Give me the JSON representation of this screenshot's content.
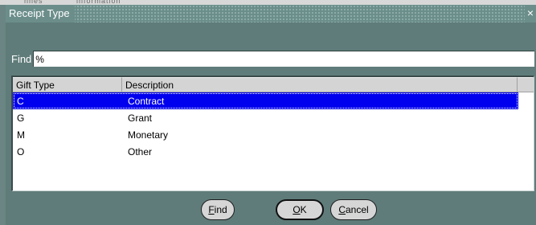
{
  "dialog": {
    "title": "Receipt Type",
    "close_glyph": "×"
  },
  "find": {
    "label": "Find",
    "value": "%"
  },
  "grid": {
    "columns": [
      "Gift Type",
      "Description"
    ],
    "rows": [
      {
        "code": "C",
        "description": "Contract",
        "selected": true
      },
      {
        "code": "G",
        "description": "Grant",
        "selected": false
      },
      {
        "code": "M",
        "description": "Monetary",
        "selected": false
      },
      {
        "code": "O",
        "description": "Other",
        "selected": false
      }
    ]
  },
  "buttons": {
    "find": {
      "mnemonic": "F",
      "rest": "ind"
    },
    "ok": {
      "mnemonic": "O",
      "rest": "K"
    },
    "cancel": {
      "mnemonic": "C",
      "rest": "ancel"
    }
  },
  "colors": {
    "window_bg": "#5f7c7a",
    "selection": "#0000ee"
  }
}
